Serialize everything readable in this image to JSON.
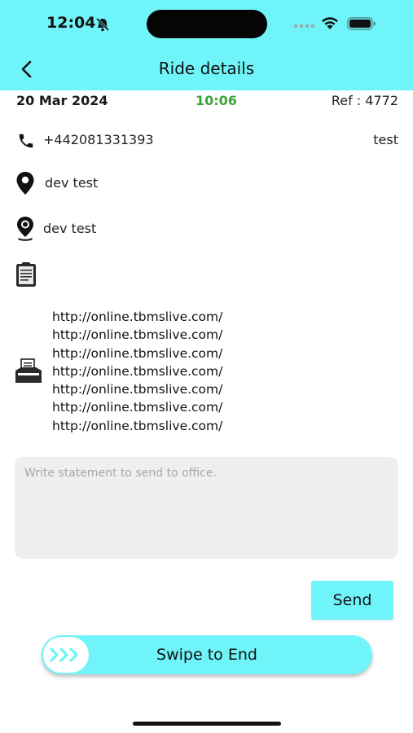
{
  "status_bar": {
    "time": "12:04"
  },
  "header": {
    "title": "Ride details"
  },
  "ride": {
    "date": "20 Mar 2024",
    "time": "10:06",
    "ref": "Ref : 4772"
  },
  "contact": {
    "phone": "+442081331393",
    "name": "test"
  },
  "pickup": {
    "address": "dev test"
  },
  "dropoff": {
    "address": "dev test"
  },
  "notes": {
    "urls": [
      "http://online.tbmslive.com/",
      "http://online.tbmslive.com/",
      "http://online.tbmslive.com/",
      "http://online.tbmslive.com/",
      "http://online.tbmslive.com/",
      "http://online.tbmslive.com/",
      "http://online.tbmslive.com/"
    ]
  },
  "statement": {
    "placeholder": "Write statement to send to office.",
    "value": ""
  },
  "actions": {
    "send_label": "Send",
    "swipe_label": "Swipe to End"
  },
  "colors": {
    "accent": "#6ff5f9",
    "time_green": "#3aa43a"
  }
}
